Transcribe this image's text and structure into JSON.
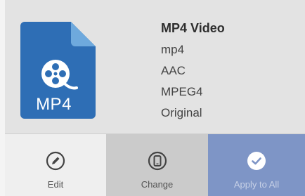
{
  "file_icon": {
    "extension_label": "MP4",
    "color": "#2e6eb5",
    "fold_color": "#6ea9dd",
    "icon": "film-reel-icon"
  },
  "format_info": {
    "title": "MP4 Video",
    "container": "mp4",
    "audio_codec": "AAC",
    "video_codec": "MPEG4",
    "resolution": "Original"
  },
  "actions": {
    "edit": {
      "label": "Edit",
      "icon": "pencil-circle-icon"
    },
    "change": {
      "label": "Change",
      "icon": "device-circle-icon"
    },
    "apply_to_all": {
      "label": "Apply to All",
      "icon": "check-circle-icon"
    }
  }
}
